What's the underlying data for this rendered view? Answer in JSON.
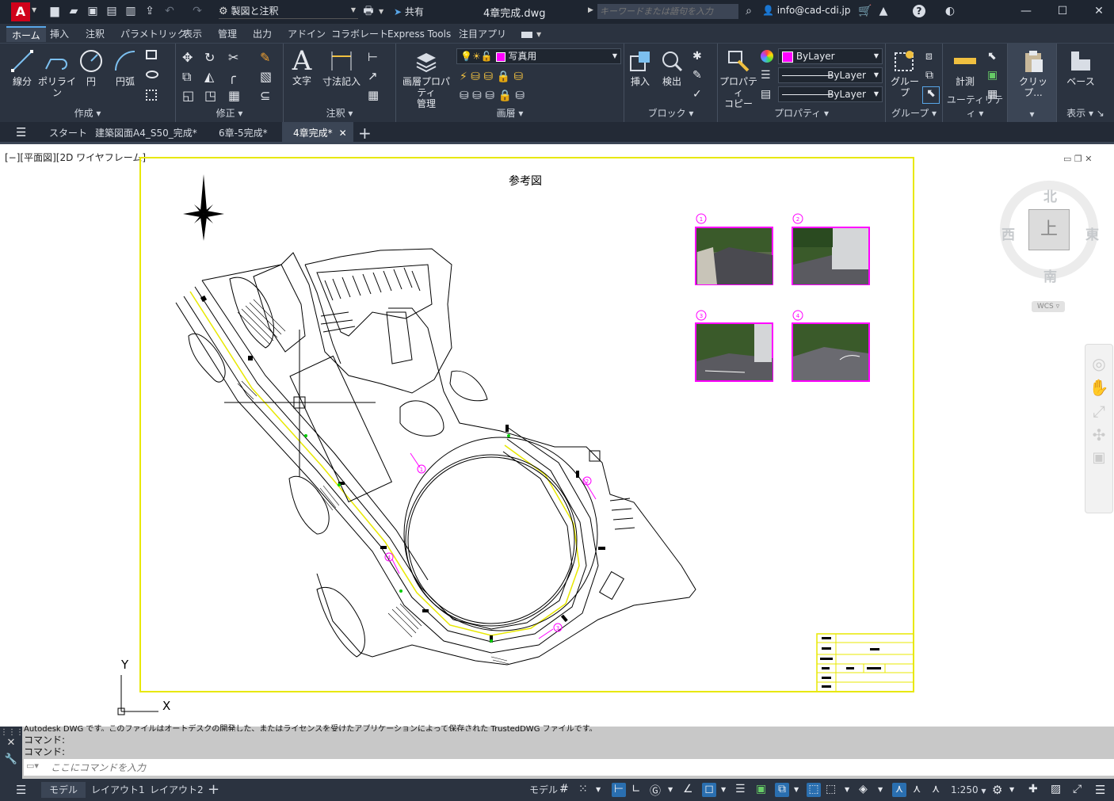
{
  "titlebar": {
    "app_letter": "A",
    "workspace": "製図と注釈",
    "share": "共有",
    "doc_title": "4章完成.dwg",
    "search_placeholder": "キーワードまたは語句を入力",
    "user": "info@cad-cdi.jp"
  },
  "menu": {
    "tabs": [
      "ホーム",
      "挿入",
      "注釈",
      "パラメトリック",
      "表示",
      "管理",
      "出力",
      "アドイン",
      "コラボレート",
      "Express Tools",
      "注目アプリ"
    ]
  },
  "ribbon": {
    "create": {
      "title": "作成",
      "line": "線分",
      "polyline": "ポリライン",
      "circle": "円",
      "arc": "円弧"
    },
    "modify": {
      "title": "修正"
    },
    "annotation": {
      "title": "注釈",
      "text": "文字",
      "dim": "寸法記入"
    },
    "layers": {
      "title": "画層",
      "props": "画層プロパティ",
      "props2": "管理",
      "current": "写真用"
    },
    "block": {
      "title": "ブロック",
      "insert": "挿入",
      "find": "検出"
    },
    "properties": {
      "title": "プロパティ",
      "copy": "プロパティ",
      "copy2": "コピー",
      "color": "ByLayer",
      "linetype": "ByLayer",
      "lineweight": "ByLayer"
    },
    "groups": {
      "title": "グループ",
      "group": "グループ"
    },
    "utilities": {
      "title": "ユーティリティ",
      "measure": "計測"
    },
    "clipboard": {
      "title": "",
      "paste": "クリップ..."
    },
    "view": {
      "title": "表示",
      "base": "ベース"
    }
  },
  "doctabs": [
    "スタート",
    "建築図面A4_S50_完成*",
    "6章-5完成*",
    "4章完成*"
  ],
  "viewport": {
    "label": "[−][平面図][2D ワイヤフレーム]"
  },
  "drawing": {
    "title": "参考図",
    "markers": [
      "1",
      "2",
      "3",
      "4"
    ]
  },
  "viewcube": {
    "n": "北",
    "s": "南",
    "e": "東",
    "w": "西",
    "face": "上",
    "wcs": "WCS"
  },
  "ucs": {
    "x": "X",
    "y": "Y"
  },
  "command": {
    "history_line": "Autodesk DWG  です。このファイルはオートデスクの開発した、またはライセンスを受けたアプリケーションによって保存された TrustedDWG ファイルです。",
    "line1": "コマンド:",
    "line2": "コマンド:",
    "placeholder": "ここにコマンドを入力"
  },
  "status": {
    "tabs": [
      "モデル",
      "レイアウト1",
      "レイアウト2"
    ],
    "model": "モデル",
    "scale": "1:250"
  },
  "colors": {
    "accent": "#e8384f",
    "magenta": "#ff00ff",
    "yellow": "#ffff00",
    "ui": "#2b3340"
  }
}
